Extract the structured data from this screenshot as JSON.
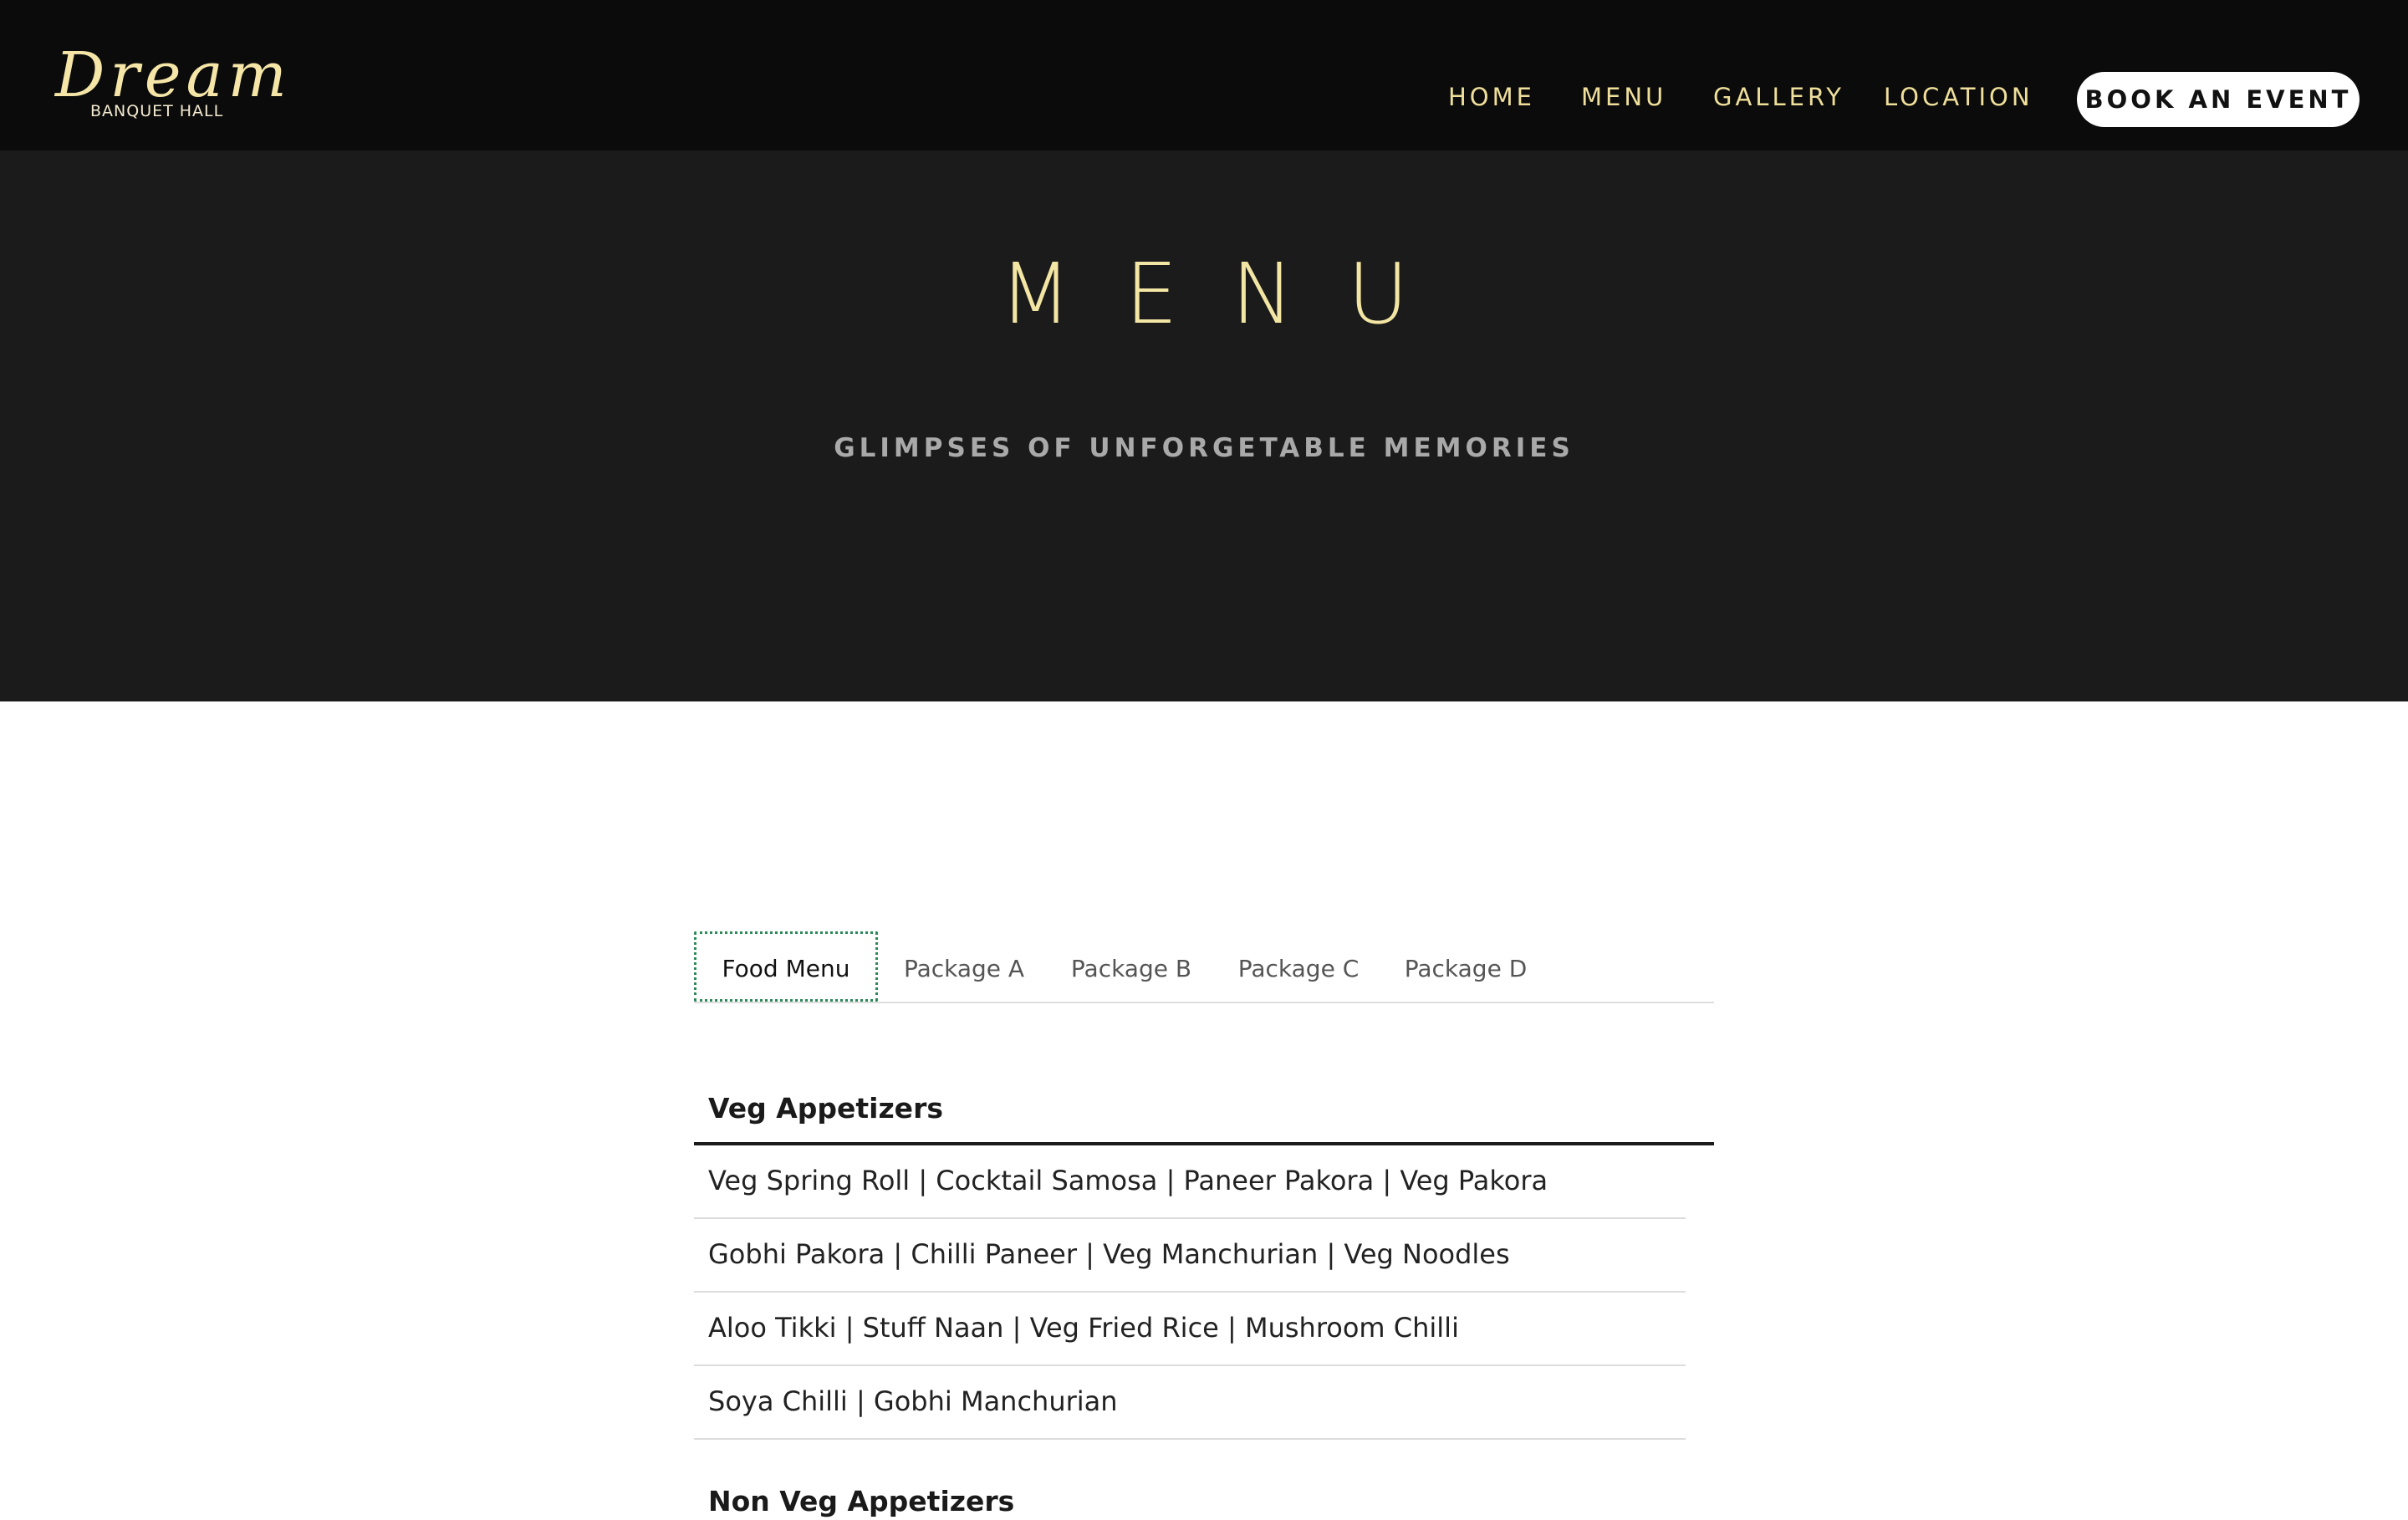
{
  "header": {
    "logo": {
      "script": "Dream",
      "subtitle": "BANQUET HALL"
    },
    "nav": [
      {
        "label": "HOME"
      },
      {
        "label": "MENU"
      },
      {
        "label": "GALLERY"
      },
      {
        "label": "LOCATION"
      }
    ],
    "cta_label": "BOOK AN EVENT"
  },
  "hero": {
    "title": "MENU",
    "subtitle": "GLIMPSES OF UNFORGETABLE MEMORIES"
  },
  "tabs": [
    {
      "label": "Food Menu",
      "active": true
    },
    {
      "label": "Package A",
      "active": false
    },
    {
      "label": "Package B",
      "active": false
    },
    {
      "label": "Package C",
      "active": false
    },
    {
      "label": "Package D",
      "active": false
    }
  ],
  "menu": {
    "sections": [
      {
        "heading": "Veg Appetizers",
        "rows": [
          "Veg Spring Roll | Cocktail Samosa | Paneer Pakora | Veg Pakora",
          "Gobhi Pakora | Chilli Paneer | Veg Manchurian | Veg Noodles",
          "Aloo Tikki | Stuff Naan | Veg Fried Rice | Mushroom Chilli",
          "Soya Chilli | Gobhi Manchurian"
        ]
      },
      {
        "heading": "Non Veg Appetizers",
        "rows": []
      }
    ]
  },
  "colors": {
    "nav_bg": "#0b0b0b",
    "hero_bg": "#1b1b1b",
    "gold": "#efdf9b",
    "active_tab_outline": "#2c8a58"
  }
}
